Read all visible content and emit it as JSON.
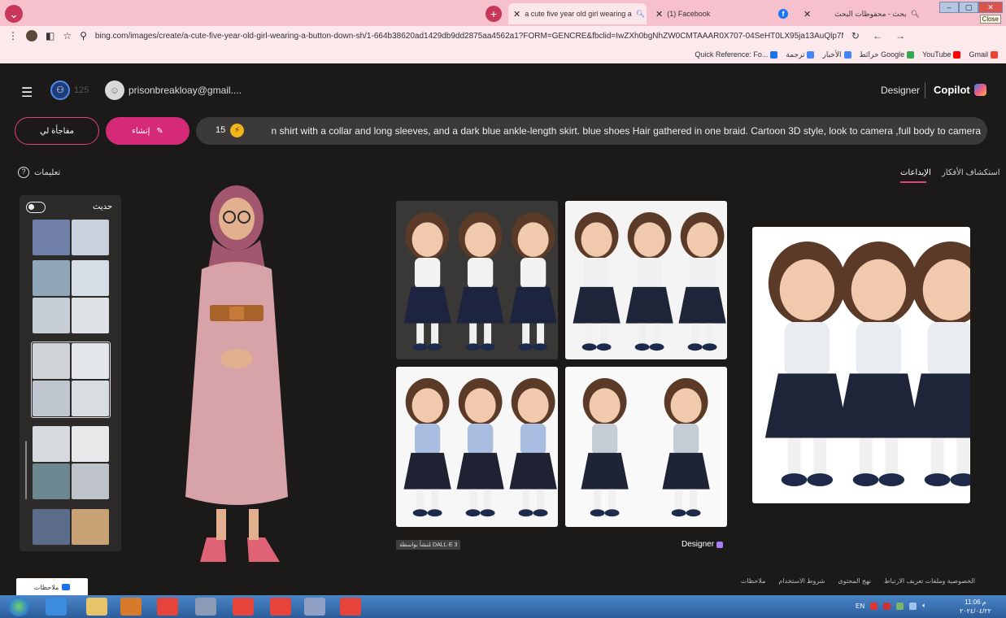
{
  "browser": {
    "tabs": [
      {
        "title": "a cute five year old girl wearing a",
        "close": "✕",
        "active": true
      },
      {
        "title": "(1) Facebook",
        "close": "✕",
        "active": false
      },
      {
        "title": "بحث - محفوظات البحث",
        "close": "✕",
        "active": false
      }
    ],
    "close_tooltip": "Close",
    "url": "bing.com/images/create/a-cute-five-year-old-girl-wearing-a-button-down-sh/1-664b38620ad1429db9dd2875aa4562a1?FORM=GENCRE&fbclid=IwZXh0bgNhZW0CMTAAAR0X707-04SeHT0LX95ja13AuQlp7MGbttBhdk...",
    "bookmarks": [
      {
        "label": "Gmail",
        "color": "#ea4335"
      },
      {
        "label": "YouTube",
        "color": "#ff0000"
      },
      {
        "label": "خرائط Google",
        "color": "#34a853"
      },
      {
        "label": "الأخبار",
        "color": "#4285f4"
      },
      {
        "label": "ترجمة",
        "color": "#4285f4"
      },
      {
        "label": "Quick Reference: Fo...",
        "color": "#1a73e8"
      }
    ]
  },
  "header": {
    "reward_count": "125",
    "user_email": "prisonbreakloay@gmail....",
    "designer_label": "Designer",
    "copilot_label": "Copilot"
  },
  "composer": {
    "surprise_label": "مفاجأة لي",
    "create_label": "إنشاء",
    "boost_count": "15",
    "prompt_text": "n shirt with a collar and long sleeves, and a dark blue ankle-length skirt. blue shoes Hair gathered in one braid. Cartoon 3D style, look to camera ,full body to camera"
  },
  "nav": {
    "help_label": "تعليمات",
    "tab_ideas": "استكشاف الأفكار",
    "tab_creations": "الإبداعات"
  },
  "sidebar": {
    "recent_label": "حديث",
    "groups": [
      {
        "selected": false,
        "colors": [
          "#6f7fa8",
          "#c9d1de"
        ]
      },
      {
        "selected": false,
        "colors": [
          "#8fa7b8",
          "#d6dde4",
          "#c7ced6",
          "#dfe3e8"
        ]
      },
      {
        "selected": true,
        "colors": [
          "#cfd3d8",
          "#e3e6ea",
          "#bfc6cf",
          "#d8dde2"
        ]
      },
      {
        "selected": false,
        "colors": [
          "#d6d9dd",
          "#e6e8ea",
          "#6d8791",
          "#bfc4ca"
        ]
      },
      {
        "selected": false,
        "colors": [
          "#5a6c8a",
          "#c9a276"
        ]
      }
    ]
  },
  "gallery": {
    "badge": "مُنشأ بواسطة DALL·E 3",
    "designer_mark": "Designer"
  },
  "footer": {
    "links": [
      "ملاحظات",
      "شروط الاستخدام",
      "نهج المحتوى",
      "الخصوصية وملفات تعريف الارتباط"
    ],
    "feedback_label": "ملاحظات"
  },
  "taskbar": {
    "lang": "EN",
    "time": "11:06 م",
    "date": "٢٠٢٤/٠٤/٢٢"
  }
}
